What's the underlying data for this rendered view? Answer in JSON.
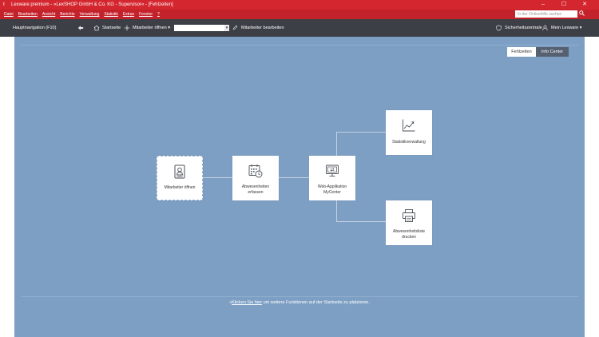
{
  "window": {
    "title": "Lexware premium - »LexSHOP GmbH & Co. KG - Supervisor« - [Fehlzeiten]",
    "controls": [
      "–",
      "☐",
      "✕"
    ]
  },
  "menubar": {
    "items": [
      "Datei",
      "Bearbeiten",
      "Ansicht",
      "Berichte",
      "Verwaltung",
      "Statistik",
      "Extras",
      "Fenster",
      "?"
    ],
    "help_search_placeholder": "In der Onlinehilfe suchen"
  },
  "toolbar": {
    "nav_label": "Hauptnavigation (F10)",
    "home_label": "Startseite",
    "open_employee_label": "Mitarbeiter öffnen",
    "employee_select_value": "",
    "edit_employee_label": "Mitarbeiter bearbeiten",
    "security_label": "Sicherheitszentrale",
    "account_label": "Mein Lexware"
  },
  "tabs": [
    {
      "label": "Fehlzeiten",
      "active": true
    },
    {
      "label": "Info Center",
      "active": false
    }
  ],
  "tiles": {
    "open_employee": "Mitarbeiter öffnen",
    "record_absences": "Abwesenheiten erfassen",
    "web_app": "Web-Applikation MyCenter",
    "statistics": "Statistikverwaltung",
    "print_absences": "Abwesenheitsliste drucken"
  },
  "footer": {
    "prefix": "»",
    "link": "Klicken Sie hier",
    "suffix": " um weitere Funktionen auf der Startseite zu platzieren."
  },
  "icons": {
    "accent": "#d4262f",
    "toolbar_bg": "#3c4046",
    "canvas_bg": "#7d9fc4",
    "tile_icon_color": "#4a4f57"
  }
}
